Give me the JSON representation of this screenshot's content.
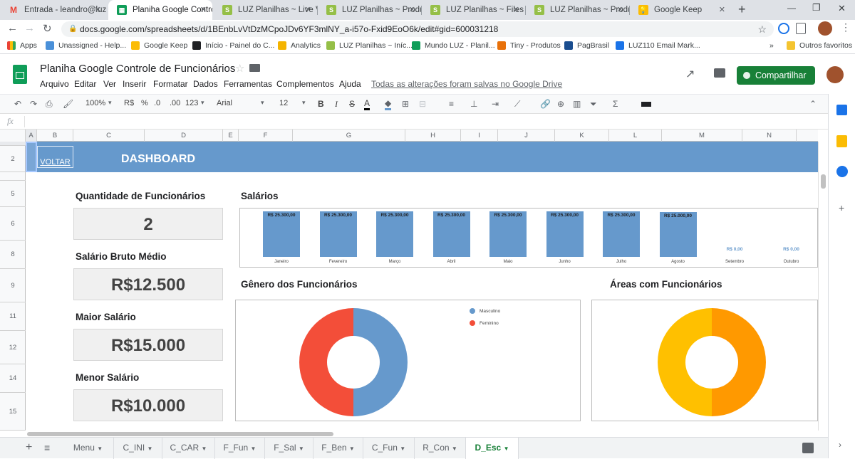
{
  "browser": {
    "tabs": [
      {
        "title": "Entrada - leandro@luz",
        "icon_color": "#ea4335",
        "icon": "gmail-icon"
      },
      {
        "title": "Planiha Google Controle",
        "icon_color": "#0f9d58",
        "icon": "sheets-icon"
      },
      {
        "title": "LUZ Planilhas ~ Live Vi",
        "icon_color": "#95bf47",
        "icon": "shopify-icon"
      },
      {
        "title": "LUZ Planilhas ~ Produt",
        "icon_color": "#95bf47",
        "icon": "shopify-icon"
      },
      {
        "title": "LUZ Planilhas ~ Files ~",
        "icon_color": "#95bf47",
        "icon": "shopify-icon"
      },
      {
        "title": "LUZ Planilhas ~ Produt",
        "icon_color": "#95bf47",
        "icon": "shopify-icon"
      },
      {
        "title": "Google Keep",
        "icon_color": "#fbbc04",
        "icon": "keep-icon"
      }
    ],
    "url": "docs.google.com/spreadsheets/d/1BEnbLvVtDzMCpoJDv6YF3mlNY_a-i57o-Fxid9EoO6k/edit#gid=600031218",
    "bookmarks": [
      {
        "label": "Apps",
        "color": "#ea4335"
      },
      {
        "label": "Unassigned - Help...",
        "color": "#4a90d9"
      },
      {
        "label": "Google Keep",
        "color": "#fbbc04"
      },
      {
        "label": "Início - Painel do C...",
        "color": "#202124"
      },
      {
        "label": "Analytics",
        "color": "#f4b400"
      },
      {
        "label": "LUZ Planilhas ~ Iníc...",
        "color": "#95bf47"
      },
      {
        "label": "Mundo LUZ - Planil...",
        "color": "#0f9d58"
      },
      {
        "label": "Tiny - Produtos",
        "color": "#e8710a"
      },
      {
        "label": "PagBrasil",
        "color": "#1a4d8f"
      },
      {
        "label": "LUZ110 Email Mark...",
        "color": "#1a73e8"
      }
    ],
    "other_favorites": "Outros favoritos",
    "more": "»"
  },
  "doc": {
    "title": "Planiha Google Controle de Funcionários",
    "menus": [
      "Arquivo",
      "Editar",
      "Ver",
      "Inserir",
      "Formatar",
      "Dados",
      "Ferramentas",
      "Complementos",
      "Ajuda"
    ],
    "save_status": "Todas as alterações foram salvas no Google Drive",
    "share_label": "Compartilhar"
  },
  "toolbar": {
    "zoom": "100%",
    "currency": "R$",
    "percent": "%",
    "dec_less": ".0",
    "dec_more": ".00",
    "format": "123",
    "font": "Arial",
    "size": "12"
  },
  "formula": {
    "fx": "fx"
  },
  "columns": [
    "A",
    "B",
    "C",
    "D",
    "E",
    "F",
    "G",
    "H",
    "I",
    "J",
    "K",
    "L",
    "M",
    "N"
  ],
  "rows": [
    "1",
    "2",
    "5",
    "6",
    "8",
    "9",
    "11",
    "12",
    "14",
    "15"
  ],
  "dashboard": {
    "back_link": "VOLTAR",
    "title": "DASHBOARD",
    "stats": [
      {
        "title": "Quantidade de Funcionários",
        "value": "2"
      },
      {
        "title": "Salário Bruto Médio",
        "value": "R$12.500"
      },
      {
        "title": "Maior Salário",
        "value": "R$15.000"
      },
      {
        "title": "Menor Salário",
        "value": "R$10.000"
      }
    ],
    "salaries_title": "Salários",
    "gender_title": "Gênero dos Funcionários",
    "areas_title": "Áreas com Funcionários"
  },
  "chart_data": [
    {
      "type": "bar",
      "title": "Salários",
      "categories": [
        "Janeiro",
        "Fevereiro",
        "Março",
        "Abril",
        "Maio",
        "Junho",
        "Julho",
        "Agosto",
        "Setembro",
        "Outubro"
      ],
      "values": [
        25300,
        25300,
        25300,
        25300,
        25300,
        25300,
        25300,
        25000,
        0,
        0
      ],
      "data_labels": [
        "R$ 25.300,00",
        "R$ 25.300,00",
        "R$ 25.300,00",
        "R$ 25.300,00",
        "R$ 25.300,00",
        "R$ 25.300,00",
        "R$ 25.300,00",
        "R$ 25.000,00",
        "R$ 0,00",
        "R$ 0,00"
      ],
      "colors": {
        "bar": "#6699cc",
        "zero_label": "#6699cc"
      }
    },
    {
      "type": "pie",
      "title": "Gênero dos Funcionários",
      "donut": true,
      "categories": [
        "Masculino",
        "Feminino"
      ],
      "values": [
        50,
        50
      ],
      "colors": [
        "#6699cc",
        "#f34e39"
      ],
      "legend": "top-right"
    },
    {
      "type": "pie",
      "title": "Áreas com Funcionários",
      "donut": true,
      "categories": [
        "",
        ""
      ],
      "values": [
        50,
        50
      ],
      "colors": [
        "#ff9900",
        "#ffc000"
      ]
    }
  ],
  "sheets": {
    "tabs": [
      "Menu",
      "C_INI",
      "C_CAR",
      "F_Fun",
      "F_Sal",
      "F_Ben",
      "C_Fun",
      "R_Con",
      "D_Esc"
    ],
    "active": "D_Esc"
  },
  "colors": {
    "banner": "#6699cc",
    "share_button": "#188038",
    "sheet_active": "#188038"
  }
}
